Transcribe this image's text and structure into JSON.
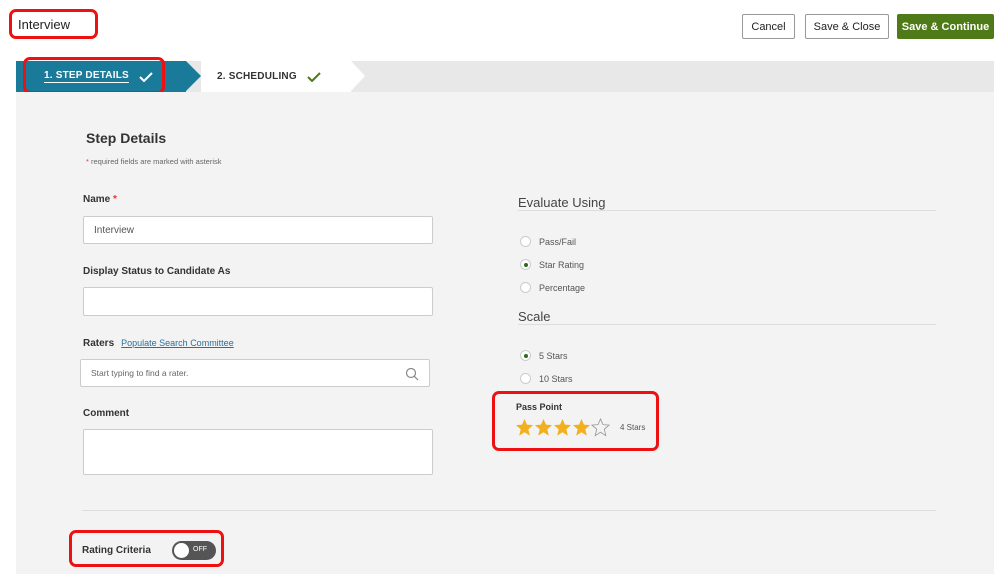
{
  "header": {
    "title": "Interview",
    "buttons": {
      "cancel": "Cancel",
      "save_close": "Save & Close",
      "save_continue": "Save & Continue"
    }
  },
  "steps": [
    {
      "label": "1. STEP DETAILS",
      "state": "active",
      "icon": "check-icon"
    },
    {
      "label": "2. SCHEDULING",
      "state": "complete",
      "icon": "check-icon"
    }
  ],
  "form": {
    "section_title": "Step Details",
    "required_note": "required fields are marked with asterisk",
    "required_mark": "*",
    "name_label": "Name",
    "name_value": "Interview",
    "display_status_label": "Display Status to Candidate As",
    "display_status_value": "",
    "raters_label": "Raters",
    "raters_link": "Populate Search Committee",
    "raters_placeholder": "Start typing to find a rater.",
    "comment_label": "Comment",
    "comment_value": ""
  },
  "evaluate": {
    "title": "Evaluate Using",
    "options": [
      "Pass/Fail",
      "Star Rating",
      "Percentage"
    ],
    "selected": "Star Rating"
  },
  "scale": {
    "title": "Scale",
    "options": [
      "5 Stars",
      "10 Stars"
    ],
    "selected": "5 Stars"
  },
  "pass_point": {
    "label": "Pass Point",
    "stars_value": 4,
    "stars_max": 5,
    "text": "4 Stars"
  },
  "rating_criteria": {
    "label": "Rating Criteria",
    "toggle_text": "OFF",
    "enabled": false
  },
  "colors": {
    "accent": "#1a7a9a",
    "primary_button": "#4f7a18",
    "highlight": "#ee1111",
    "star": "#f2b01e"
  }
}
